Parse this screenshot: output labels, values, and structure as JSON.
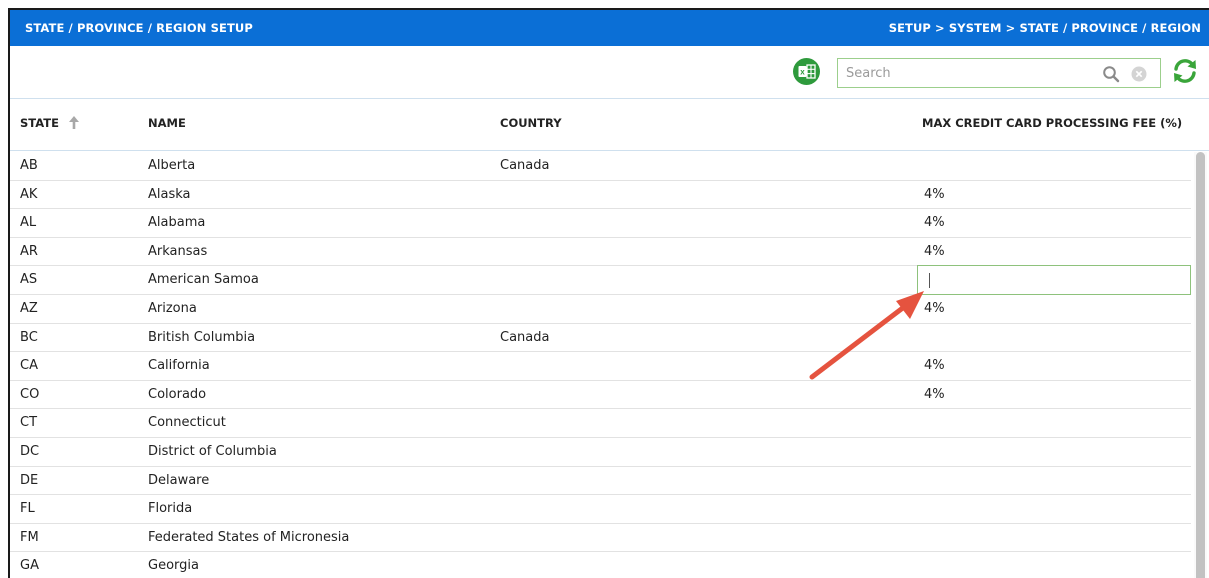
{
  "header": {
    "title": "STATE / PROVINCE / REGION SETUP",
    "breadcrumb": "SETUP > SYSTEM > STATE / PROVINCE / REGION"
  },
  "toolbar": {
    "export_icon": "excel-icon",
    "search_placeholder": "Search",
    "search_value": "",
    "refresh_icon": "refresh-icon"
  },
  "table": {
    "columns": [
      "STATE",
      "NAME",
      "COUNTRY",
      "MAX CREDIT CARD PROCESSING FEE (%)"
    ],
    "sort": {
      "column": "STATE",
      "direction": "ascending"
    },
    "rows": [
      {
        "state": "AB",
        "name": "Alberta",
        "country": "Canada",
        "fee": ""
      },
      {
        "state": "AK",
        "name": "Alaska",
        "country": "",
        "fee": "4%"
      },
      {
        "state": "AL",
        "name": "Alabama",
        "country": "",
        "fee": "4%"
      },
      {
        "state": "AR",
        "name": "Arkansas",
        "country": "",
        "fee": "4%"
      },
      {
        "state": "AS",
        "name": "American Samoa",
        "country": "",
        "fee": "",
        "editing": true
      },
      {
        "state": "AZ",
        "name": "Arizona",
        "country": "",
        "fee": "4%"
      },
      {
        "state": "BC",
        "name": "British Columbia",
        "country": "Canada",
        "fee": ""
      },
      {
        "state": "CA",
        "name": "California",
        "country": "",
        "fee": "4%"
      },
      {
        "state": "CO",
        "name": "Colorado",
        "country": "",
        "fee": "4%"
      },
      {
        "state": "CT",
        "name": "Connecticut",
        "country": "",
        "fee": ""
      },
      {
        "state": "DC",
        "name": "District of Columbia",
        "country": "",
        "fee": ""
      },
      {
        "state": "DE",
        "name": "Delaware",
        "country": "",
        "fee": ""
      },
      {
        "state": "FL",
        "name": "Florida",
        "country": "",
        "fee": ""
      },
      {
        "state": "FM",
        "name": "Federated States of Micronesia",
        "country": "",
        "fee": ""
      },
      {
        "state": "GA",
        "name": "Georgia",
        "country": "",
        "fee": ""
      }
    ]
  },
  "colors": {
    "header_bar": "#0b6fd6",
    "excel_green": "#2e9a3c",
    "refresh_green": "#3aa53a",
    "edit_border": "#8ec27c",
    "annotation_arrow": "#e5533f"
  }
}
